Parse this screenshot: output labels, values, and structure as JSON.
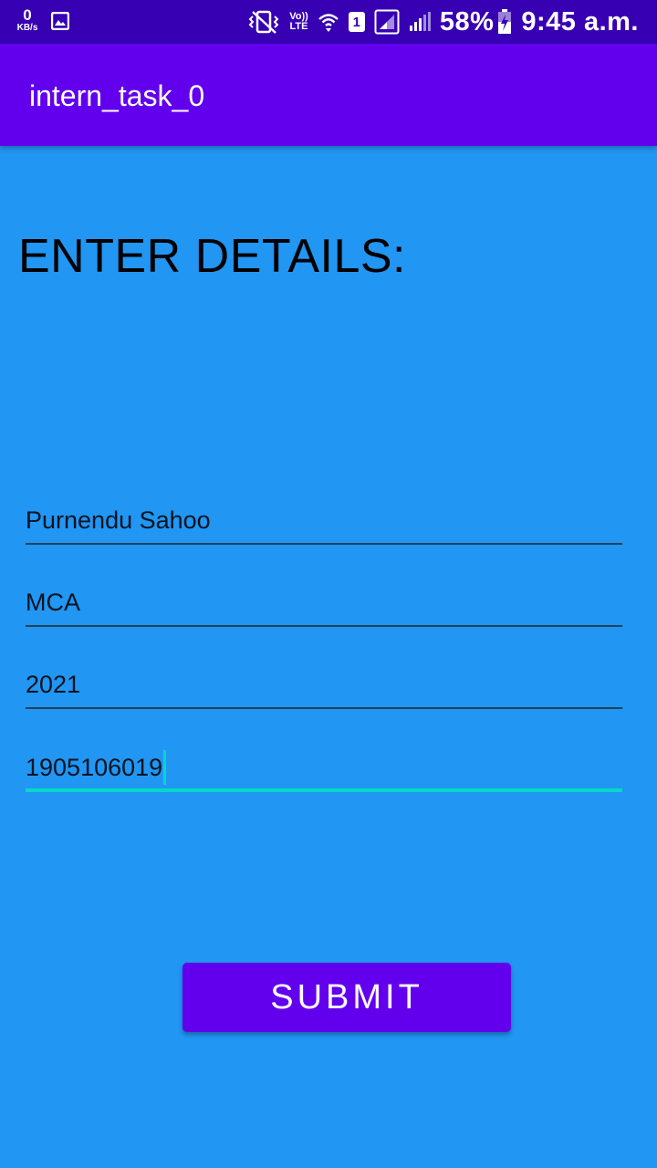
{
  "status_bar": {
    "speed_value": "0",
    "speed_unit": "KB/s",
    "volte_top": "Vo))",
    "volte_bottom": "LTE",
    "sim_number": "1",
    "battery": "58%",
    "time": "9:45 a.m.",
    "icons": [
      "gallery-icon",
      "vibrate-icon",
      "volte-icon",
      "wifi-icon",
      "sim-icon",
      "signal-icon",
      "signal-icon",
      "battery-charging-icon"
    ]
  },
  "app_bar": {
    "title": "intern_task_0"
  },
  "form": {
    "heading": "ENTER DETAILS:",
    "fields": [
      {
        "value": "Purnendu Sahoo"
      },
      {
        "value": "MCA"
      },
      {
        "value": "2021"
      },
      {
        "value": "1905106019",
        "focused": true
      }
    ],
    "submit_label": "SUBMIT"
  },
  "colors": {
    "status_bar": "#3700B3",
    "app_bar": "#6200EE",
    "background": "#2196F3",
    "accent": "#03DAC5",
    "button": "#6200EE"
  }
}
